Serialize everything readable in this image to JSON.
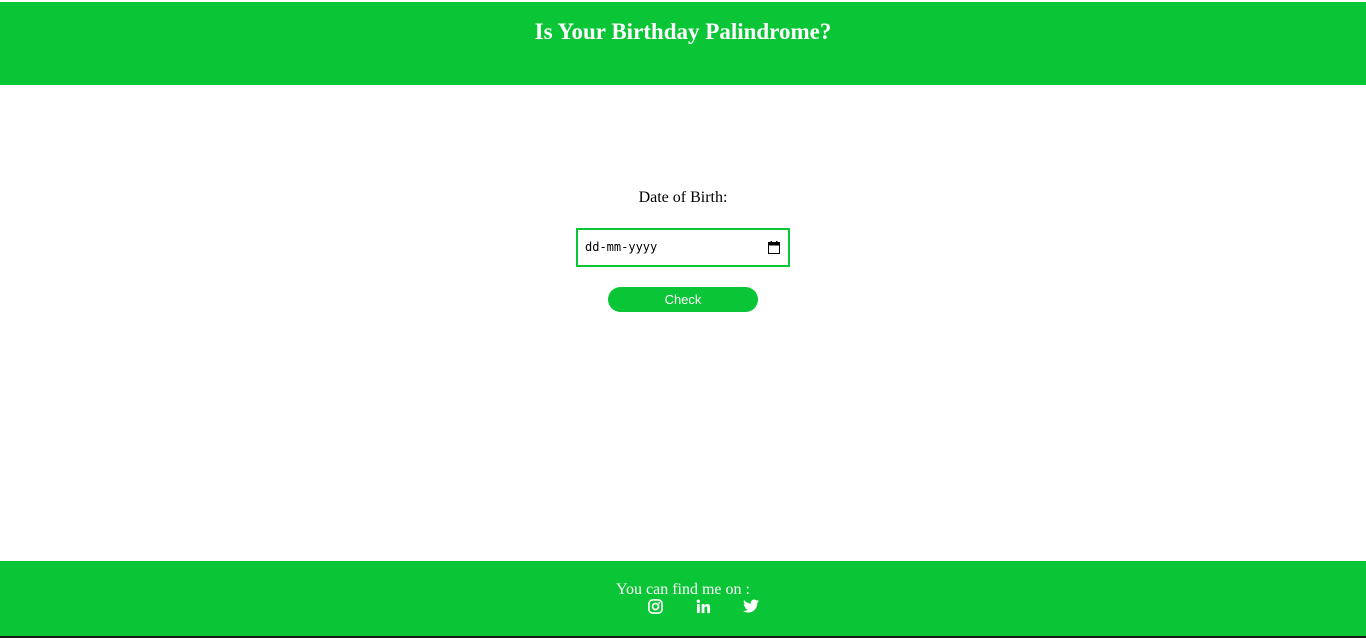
{
  "header": {
    "title": "Is Your Birthday Palindrome?"
  },
  "form": {
    "dob_label": "Date of Birth:",
    "date_placeholder": "dd-mm-yyyy",
    "check_label": "Check"
  },
  "footer": {
    "find_text": "You can find me on :",
    "social": [
      {
        "icon": "instagram-icon"
      },
      {
        "icon": "linkedin-icon"
      },
      {
        "icon": "twitter-icon"
      }
    ]
  },
  "colors": {
    "accent": "#0ac535",
    "text_on_accent": "#ffffff"
  }
}
